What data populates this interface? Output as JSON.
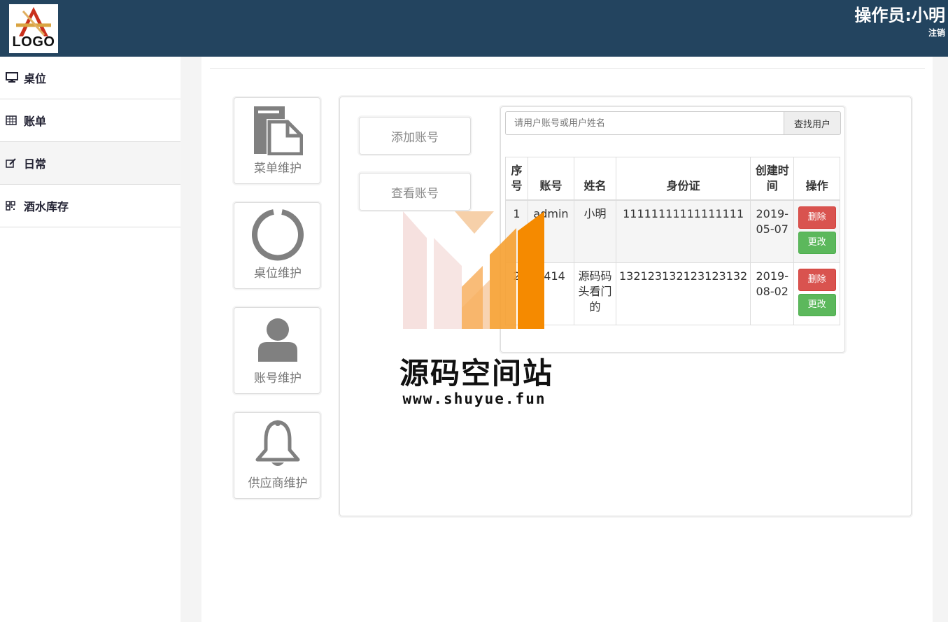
{
  "header": {
    "logo_text": "LOGO",
    "operator": "操作员:小明",
    "logout": "注销"
  },
  "sidebar": {
    "items": [
      {
        "label": "桌位",
        "icon": "monitor-icon"
      },
      {
        "label": "账单",
        "icon": "table-icon"
      },
      {
        "label": "日常",
        "icon": "edit-icon"
      },
      {
        "label": "酒水库存",
        "icon": "qrcode-icon"
      }
    ]
  },
  "cards": [
    {
      "label": "菜单维护",
      "icon": "file-icon"
    },
    {
      "label": "桌位维护",
      "icon": "circle-icon"
    },
    {
      "label": "账号维护",
      "icon": "user-icon"
    },
    {
      "label": "供应商维护",
      "icon": "bell-icon"
    }
  ],
  "actions": {
    "add": "添加账号",
    "view": "查看账号"
  },
  "search": {
    "placeholder": "请用户账号或用户姓名",
    "button": "查找用户"
  },
  "table": {
    "headers": [
      "序号",
      "账号",
      "姓名",
      "身份证",
      "创建时间",
      "操作"
    ],
    "rows": [
      {
        "no": "1",
        "account": "admin",
        "name": "小明",
        "id_card": "11111111111111111",
        "created": "2019-05-07"
      },
      {
        "no": "2",
        "account": "1414",
        "name": "源码码头看门的",
        "id_card": "132123132123123132",
        "created": "2019-08-02"
      }
    ],
    "delete_label": "删除",
    "update_label": "更改"
  },
  "watermark": {
    "title": "源码空间站",
    "url": "www.shuyue.fun"
  },
  "colors": {
    "header_bg": "#23445f",
    "delete": "#d9534f",
    "update": "#5cb85c"
  }
}
